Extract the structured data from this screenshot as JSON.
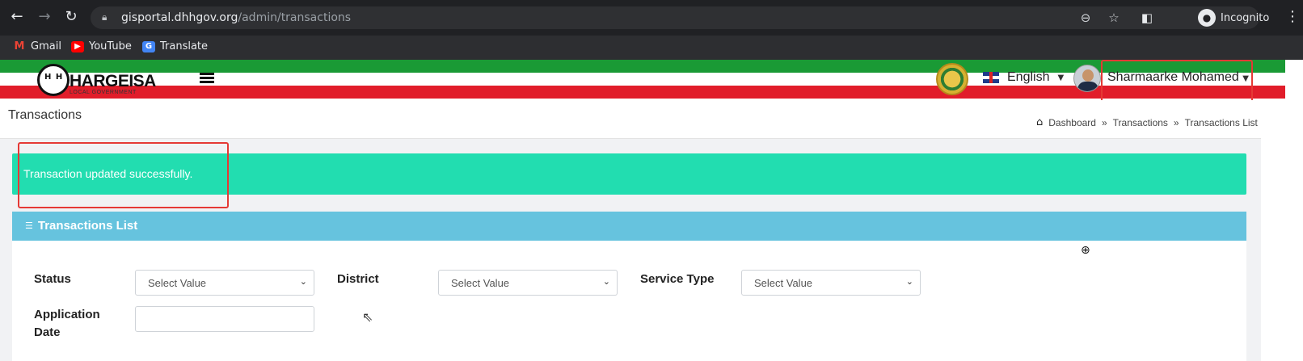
{
  "browser": {
    "url_domain": "gisportal.dhhgov.org",
    "url_path": "/admin/transactions",
    "profile_label": "Incognito",
    "bookmarks": [
      {
        "label": "Gmail"
      },
      {
        "label": "YouTube"
      },
      {
        "label": "Translate"
      }
    ]
  },
  "header": {
    "logo_name": "HARGEISA",
    "logo_subtitle": "LOCAL GOVERNMENT",
    "language": "English",
    "user_name": "Sharmaarke Mohamed"
  },
  "page": {
    "title": "Transactions",
    "breadcrumb": [
      "Dashboard",
      "Transactions",
      "Transactions List"
    ],
    "breadcrumb_separator": "»"
  },
  "alert": {
    "message": "Transaction updated successfully.",
    "color": "#22ddb0"
  },
  "card": {
    "title": "Transactions List",
    "header_color": "#66c3de",
    "filters": {
      "status": {
        "label": "Status",
        "value": "Select Value"
      },
      "district": {
        "label": "District",
        "value": "Select Value"
      },
      "service_type": {
        "label": "Service Type",
        "value": "Select Value"
      },
      "application_date": {
        "label_line1": "Application",
        "label_line2": "Date",
        "value": ""
      }
    }
  },
  "colors": {
    "flag_green": "#1a9a35",
    "flag_red": "#e11d2a",
    "highlight": "#e53935"
  }
}
